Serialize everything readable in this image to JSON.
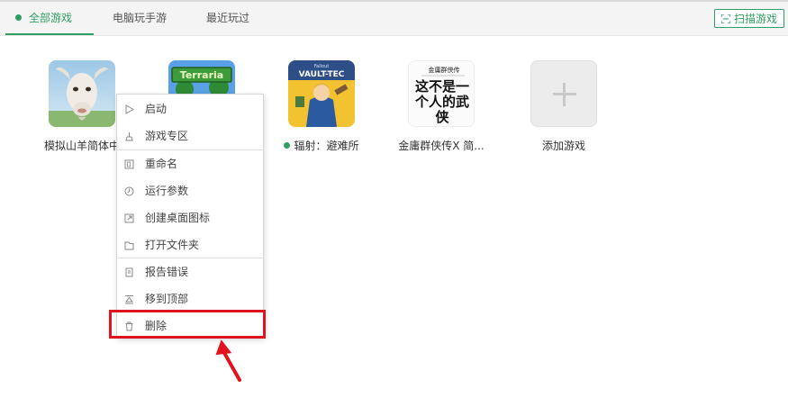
{
  "tabs": [
    {
      "label": "全部游戏",
      "active": true
    },
    {
      "label": "电脑玩手游",
      "active": false
    },
    {
      "label": "最近玩过",
      "active": false
    }
  ],
  "scan_button": {
    "label": "扫描游戏",
    "icon": "scan-icon"
  },
  "games": [
    {
      "name": "模拟山羊简体中",
      "icon": "goat-icon"
    },
    {
      "name": "",
      "icon": "terraria-icon"
    },
    {
      "name": "辐射：避难所",
      "icon": "vault-tec-icon",
      "running": true
    },
    {
      "name": "金庸群侠传X 简...",
      "icon": "wuxia-calligraphy-icon"
    },
    {
      "name": "添加游戏",
      "icon": "plus-icon"
    }
  ],
  "game_tile_text": {
    "terraria": "Terraria",
    "vault_small": "Fallout",
    "vault_main": "VAULT-TEC",
    "wuxia_top": "金庸群侠传",
    "wuxia_main": "这不是一个人的武侠"
  },
  "context_menu": {
    "items": [
      {
        "label": "启动",
        "icon": "play-icon"
      },
      {
        "label": "游戏专区",
        "icon": "zone-icon"
      },
      {
        "label": "重命名",
        "icon": "rename-icon"
      },
      {
        "label": "运行参数",
        "icon": "params-icon"
      },
      {
        "label": "创建桌面图标",
        "icon": "shortcut-icon"
      },
      {
        "label": "打开文件夹",
        "icon": "folder-icon"
      },
      {
        "label": "报告错误",
        "icon": "report-icon"
      },
      {
        "label": "移到顶部",
        "icon": "move-top-icon"
      },
      {
        "label": "删除",
        "icon": "trash-icon"
      }
    ]
  },
  "colors": {
    "accent": "#2f9e62",
    "highlight": "#e0141e",
    "arrow": "#e0141e"
  }
}
